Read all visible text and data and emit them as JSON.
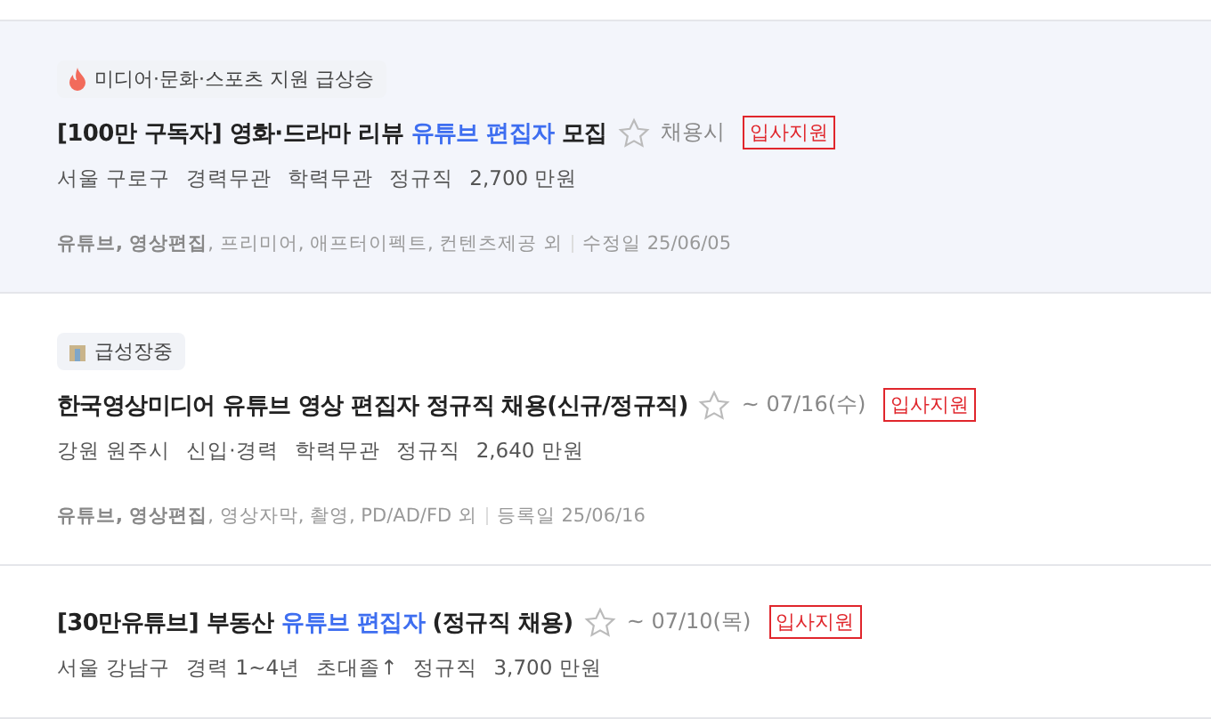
{
  "jobs": [
    {
      "highlighted": true,
      "badge": {
        "kind": "fire",
        "text": "미디어·문화·스포츠 지원 급상승"
      },
      "title": [
        {
          "text": "[100만 구독자] 영화·드라마 리뷰 ",
          "highlight": false
        },
        {
          "text": "유튜브 편집자",
          "highlight": true
        },
        {
          "text": " 모집",
          "highlight": false
        }
      ],
      "starred": false,
      "deadline": "채용시",
      "apply": "입사지원",
      "meta": [
        "서울 구로구",
        "경력무관",
        "학력무관",
        "정규직",
        "2,700 만원"
      ],
      "tags": "**유튜브, 영상편집**, 프리미어, 애프터이펙트, 컨텐츠제공 외",
      "date": "수정일 25/06/05"
    },
    {
      "highlighted": false,
      "badge": {
        "kind": "building",
        "text": "급성장중"
      },
      "title": [
        {
          "text": "한국영상미디어 유튜브 영상 편집자 정규직 채용(신규/정규직)",
          "highlight": false
        }
      ],
      "starred": false,
      "deadline": "~ 07/16(수)",
      "apply": "입사지원",
      "meta": [
        "강원 원주시",
        "신입·경력",
        "학력무관",
        "정규직",
        "2,640 만원"
      ],
      "tags": "**유튜브, 영상편집**, 영상자막, 촬영, PD/AD/FD 외",
      "date": "등록일 25/06/16"
    },
    {
      "highlighted": false,
      "title": [
        {
          "text": "[30만유튜브] 부동산 ",
          "highlight": false
        },
        {
          "text": "유튜브 편집자",
          "highlight": true
        },
        {
          "text": " (정규직 채용)",
          "highlight": false
        }
      ],
      "starred": false,
      "deadline": "~ 07/10(목)",
      "apply": "입사지원",
      "meta": [
        "서울 강남구",
        "경력 1~4년",
        "초대졸↑",
        "정규직",
        "3,700 만원"
      ]
    }
  ]
}
